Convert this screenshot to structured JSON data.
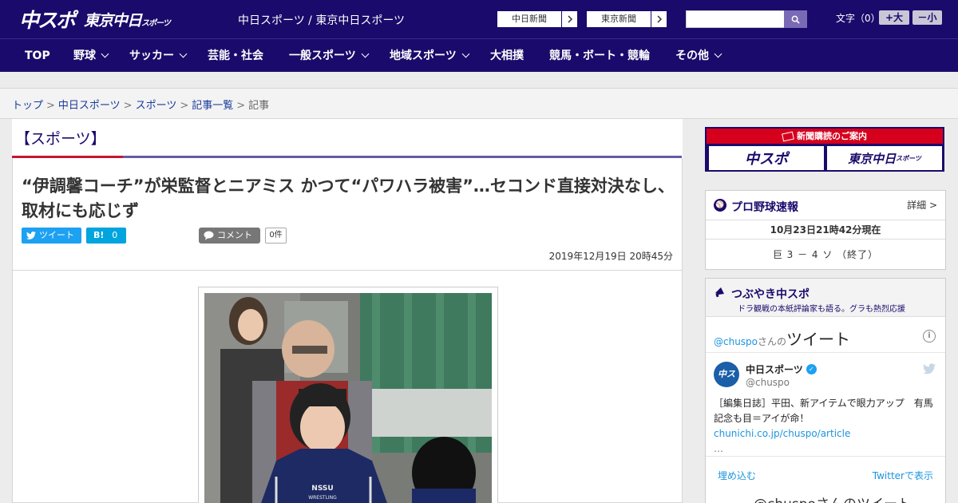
{
  "header": {
    "logo_main": "中スポ",
    "logo_tokyo": "東京中日",
    "logo_tokyo_small": "スポーツ",
    "site_links": "中日スポーツ / 東京中日スポーツ",
    "ext_links": [
      {
        "label": "中日新聞"
      },
      {
        "label": "東京新聞"
      }
    ],
    "search_placeholder": "",
    "font_size_label": "文字（0）",
    "font_bigger": "+大",
    "font_smaller": "－小"
  },
  "nav": {
    "items": [
      {
        "label": "TOP",
        "has_dropdown": false
      },
      {
        "label": "野球",
        "has_dropdown": true
      },
      {
        "label": "サッカー",
        "has_dropdown": true
      },
      {
        "label": "芸能・社会",
        "has_dropdown": false
      },
      {
        "label": "一般スポーツ",
        "has_dropdown": true
      },
      {
        "label": "地域スポーツ",
        "has_dropdown": true
      },
      {
        "label": "大相撲",
        "has_dropdown": false
      },
      {
        "label": "競馬・ボート・競輪",
        "has_dropdown": false
      },
      {
        "label": "その他",
        "has_dropdown": true
      }
    ]
  },
  "breadcrumb": {
    "items": [
      {
        "label": "トップ",
        "link": true
      },
      {
        "label": "中日スポーツ",
        "link": true
      },
      {
        "label": "スポーツ",
        "link": true
      },
      {
        "label": "記事一覧",
        "link": true
      },
      {
        "label": "記事",
        "link": false
      }
    ],
    "separator": ">"
  },
  "article": {
    "category": "【スポーツ】",
    "headline": "“伊調馨コーチ”が栄監督とニアミス かつて“パワハラ被害”…セコンド直接対決なし、取材にも応じず",
    "tweet_label": "ツイート",
    "hatena_label": "B!",
    "hatena_count": "0",
    "comment_label": "コメント",
    "comment_count": "0件",
    "date": "2019年12月19日 20時45分",
    "photo_text": "NSSU\nWRESTLING"
  },
  "sidebar": {
    "banner": {
      "top_label": "新聞購読のご案内",
      "left": "中スポ",
      "right": "東京中日",
      "right_small": "スポーツ"
    },
    "baseball": {
      "title": "プロ野球速報",
      "detail": "詳細 >",
      "time": "10月23日21時42分現在",
      "score": "巨 3 － 4 ソ （終了）"
    },
    "twitter": {
      "title": "つぶやき中スポ",
      "subtitle": "ドラ観戦の本紙評論家も語る。グラも熱烈応援",
      "account": "@chuspo",
      "account_suffix": "さんの",
      "account_label": "ツイート",
      "info": "i",
      "avatar_text": "中スポ",
      "name": "中日スポーツ",
      "handle": "@chuspo",
      "text": "［編集日誌］平田、新アイテムで眼力アップ　有馬記念も目＝アイが命！",
      "text_link": "chunichi.co.jp/chuspo/article",
      "ellipsis": "…",
      "embed": "埋め込む",
      "view": "Twitterで表示",
      "more": "@chuspoさんのツイート"
    }
  },
  "colors": {
    "brand": "#1a0a6b",
    "accent_red": "#c6162f",
    "accent_purple": "#6a5aa3",
    "twitter_blue": "#1da1f2",
    "hatena_blue": "#00a4de"
  }
}
